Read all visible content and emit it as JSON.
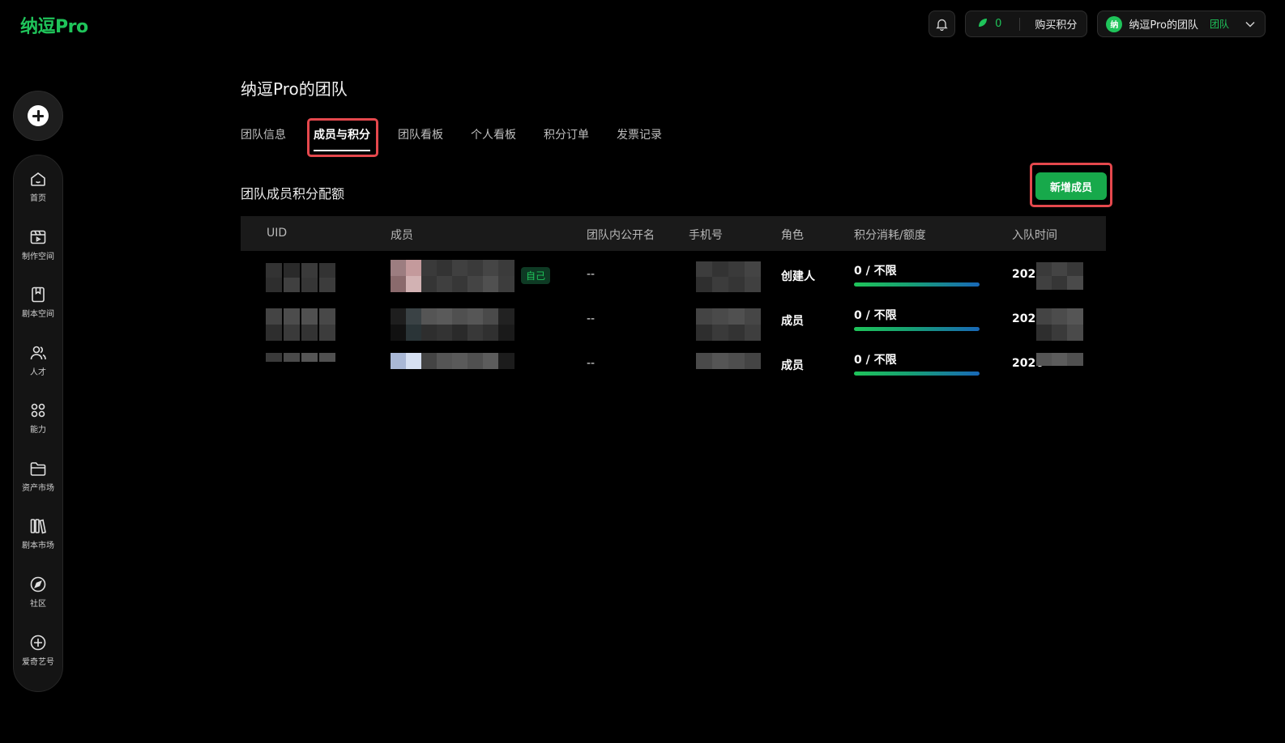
{
  "app": {
    "logo": "纳逗Pro"
  },
  "topbar": {
    "points_value": "0",
    "buy_points_label": "购买积分",
    "team_avatar_text": "纳",
    "team_name": "纳逗Pro的团队",
    "team_tag": "团队"
  },
  "sidebar": {
    "items": [
      {
        "label": "首页",
        "icon": "home-icon"
      },
      {
        "label": "制作空间",
        "icon": "video-edit-icon"
      },
      {
        "label": "剧本空间",
        "icon": "book-icon"
      },
      {
        "label": "人才",
        "icon": "people-icon"
      },
      {
        "label": "能力",
        "icon": "grid-icon"
      },
      {
        "label": "资产市场",
        "icon": "folder-icon"
      },
      {
        "label": "剧本市场",
        "icon": "library-icon"
      },
      {
        "label": "社区",
        "icon": "compass-icon"
      },
      {
        "label": "爱奇艺号",
        "icon": "plus-circle-icon"
      }
    ]
  },
  "page": {
    "title": "纳逗Pro的团队",
    "tabs": [
      "团队信息",
      "成员与积分",
      "团队看板",
      "个人看板",
      "积分订单",
      "发票记录"
    ],
    "active_tab": "成员与积分",
    "section_title": "团队成员积分配额",
    "add_member_label": "新增成员"
  },
  "table": {
    "headers": [
      "UID",
      "成员",
      "团队内公开名",
      "手机号",
      "角色",
      "积分消耗/额度",
      "入队时间"
    ],
    "rows": [
      {
        "public_name": "--",
        "role": "创建人",
        "credits": "0 / 不限",
        "credit_used_fraction": 1.0,
        "joined_prefix": "2026",
        "self_tag": "自己"
      },
      {
        "public_name": "--",
        "role": "成员",
        "credits": "0 / 不限",
        "credit_used_fraction": 1.0,
        "joined_prefix": "2026",
        "self_tag": ""
      },
      {
        "public_name": "--",
        "role": "成员",
        "credits": "0 / 不限",
        "credit_used_fraction": 1.0,
        "joined_prefix": "2026",
        "self_tag": ""
      }
    ]
  },
  "colors": {
    "accent": "#1fc45a",
    "highlight": "#e5484d",
    "button": "#17a94b"
  }
}
